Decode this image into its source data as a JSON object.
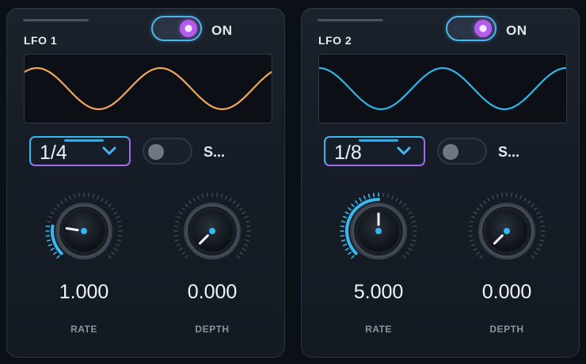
{
  "lfos": [
    {
      "title": "LFO 1",
      "power": {
        "state": "on",
        "label": "ON"
      },
      "waveform": {
        "shape": "sine",
        "color": "#f2a65a"
      },
      "rate_select": {
        "value": "1/4",
        "icon": "chevron-down-icon"
      },
      "sync": {
        "state": "off",
        "label": "S..."
      },
      "knobs": [
        {
          "label": "RATE",
          "value": "1.000",
          "fraction": 0.2
        },
        {
          "label": "DEPTH",
          "value": "0.000",
          "fraction": 0.0
        }
      ]
    },
    {
      "title": "LFO 2",
      "power": {
        "state": "on",
        "label": "ON"
      },
      "waveform": {
        "shape": "sine",
        "color": "#2fb6e8"
      },
      "rate_select": {
        "value": "1/8",
        "icon": "chevron-down-icon"
      },
      "sync": {
        "state": "off",
        "label": "S..."
      },
      "knobs": [
        {
          "label": "RATE",
          "value": "5.000",
          "fraction": 0.5
        },
        {
          "label": "DEPTH",
          "value": "0.000",
          "fraction": 0.0
        }
      ]
    }
  ],
  "colors": {
    "accent_blue": "#3bb7ef",
    "accent_purple": "#a86cf0"
  }
}
